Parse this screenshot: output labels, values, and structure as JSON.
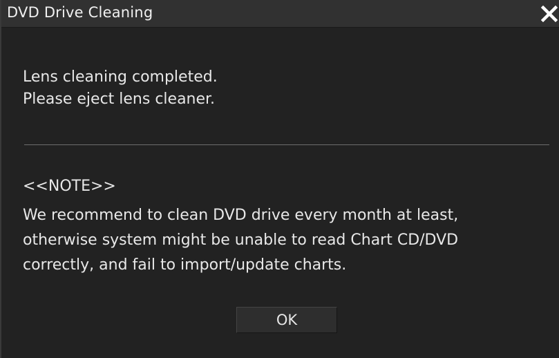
{
  "dialog": {
    "title": "DVD Drive Cleaning",
    "message_lines": [
      "Lens cleaning completed.",
      "Please eject lens cleaner."
    ],
    "note_header": "<<NOTE>>",
    "note_lines": [
      "We recommend to clean DVD drive every month at least,",
      "otherwise system might be unable to read Chart CD/DVD",
      "correctly, and fail to import/update charts."
    ],
    "ok_label": "OK",
    "close_icon": "close-icon"
  },
  "colors": {
    "background": "#222222",
    "titlebar": "#313131",
    "text": "#e8e8e8",
    "divider": "#6e6e6e"
  }
}
